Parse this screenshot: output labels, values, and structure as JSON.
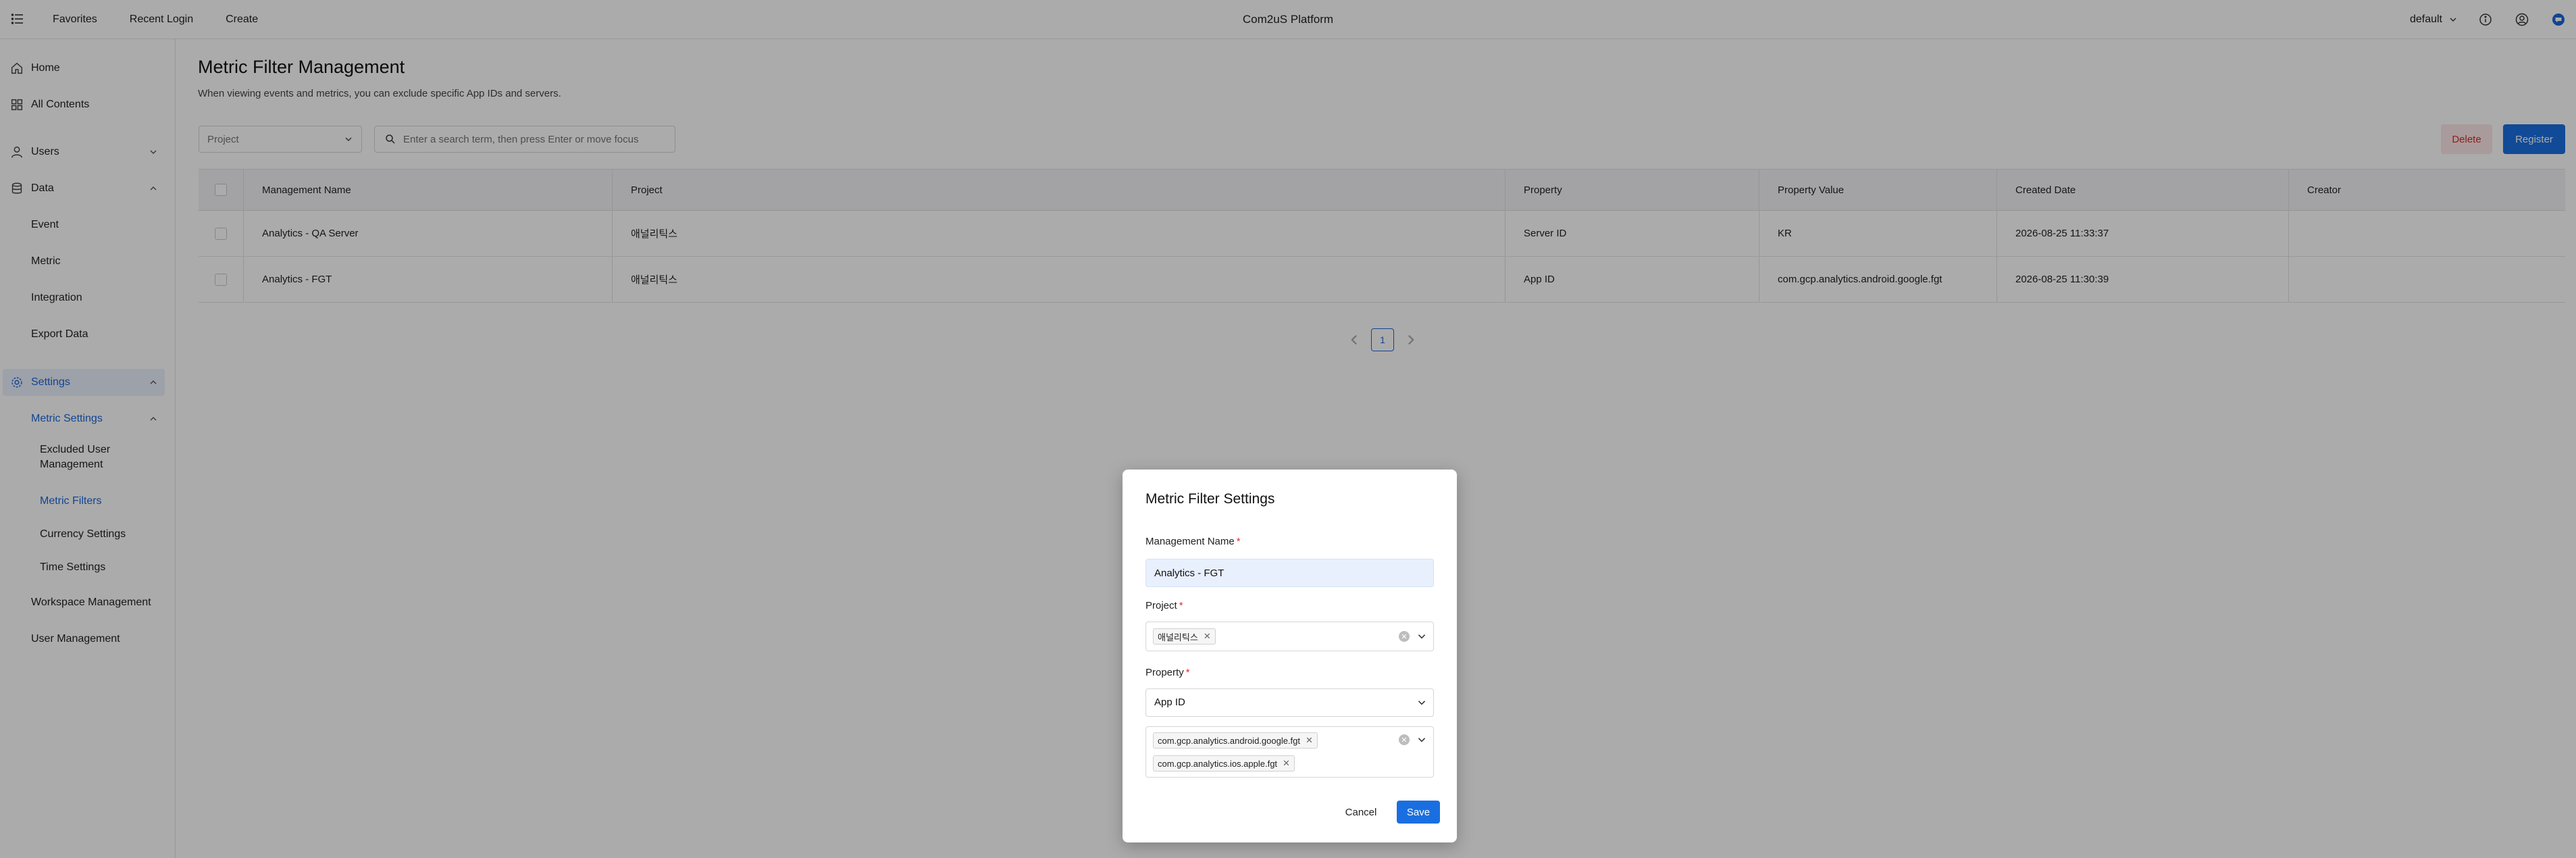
{
  "topbar": {
    "nav": [
      "Favorites",
      "Recent Login",
      "Create"
    ],
    "app_title": "Com2uS Platform",
    "workspace": "default"
  },
  "sidebar": {
    "home": "Home",
    "all_contents": "All Contents",
    "users": "Users",
    "data": "Data",
    "data_items": [
      "Event",
      "Metric",
      "Integration",
      "Export Data"
    ],
    "settings": "Settings",
    "metric_settings": "Metric Settings",
    "excluded_user_line1": "Excluded User",
    "excluded_user_line2": "Management",
    "metric_filters": "Metric Filters",
    "currency_settings": "Currency Settings",
    "time_settings": "Time Settings",
    "workspace_management": "Workspace Management",
    "user_management": "User Management"
  },
  "main": {
    "title": "Metric Filter Management",
    "description": "When viewing events and metrics, you can exclude specific App IDs and servers.",
    "project_filter_placeholder": "Project",
    "search_placeholder": "Enter a search term, then press Enter or move focus",
    "delete_label": "Delete",
    "register_label": "Register",
    "columns": [
      "Management Name",
      "Project",
      "Property",
      "Property Value",
      "Created Date",
      "Creator"
    ],
    "rows": [
      [
        "Analytics - QA Server",
        "애널리틱스",
        "Server ID",
        "KR",
        "2026-08-25 11:33:37",
        ""
      ],
      [
        "Analytics - FGT",
        "애널리틱스",
        "App ID",
        "com.gcp.analytics.android.google.fgt",
        "2026-08-25 11:30:39",
        ""
      ]
    ],
    "current_page": "1"
  },
  "modal": {
    "title": "Metric Filter Settings",
    "name_label": "Management Name",
    "name_value": "Analytics - FGT",
    "project_label": "Project",
    "project_tags": [
      "애널리틱스"
    ],
    "property_label": "Property",
    "property_value": "App ID",
    "property_value_tags": [
      "com.gcp.analytics.android.google.fgt",
      "com.gcp.analytics.ios.apple.fgt"
    ],
    "cancel_label": "Cancel",
    "save_label": "Save",
    "required_mark": "*"
  },
  "colors": {
    "accent": "#1a6fe0",
    "active_text": "#1a66d9",
    "danger": "#d0312d",
    "overlay": "rgba(0,0,0,0.33)"
  }
}
